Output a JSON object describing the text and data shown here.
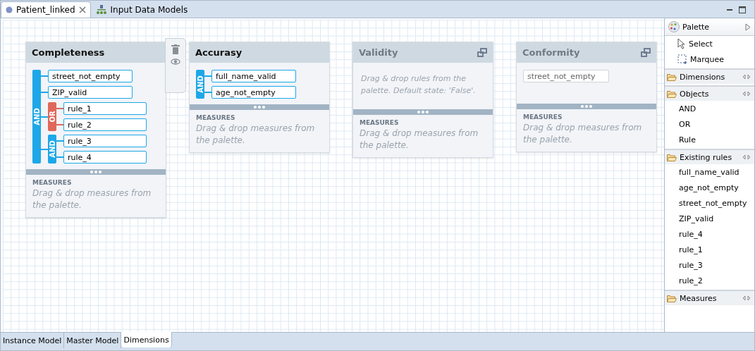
{
  "editor_tabs": [
    {
      "label": "Patient_linked",
      "selected": true,
      "closable": true,
      "kind": "document"
    },
    {
      "label": "Input Data Models",
      "selected": false,
      "closable": false,
      "kind": "model"
    }
  ],
  "cards": [
    {
      "title": "Completeness",
      "selected": true,
      "disabled": false,
      "rules": [
        {
          "kind": "and",
          "label": "AND",
          "children": [
            {
              "kind": "rule",
              "name": "street_not_empty"
            },
            {
              "kind": "rule",
              "name": "ZIP_valid"
            },
            {
              "kind": "or",
              "label": "OR",
              "children": [
                {
                  "kind": "rule",
                  "name": "rule_1"
                },
                {
                  "kind": "rule",
                  "name": "rule_2"
                }
              ]
            },
            {
              "kind": "and",
              "label": "AND",
              "children": [
                {
                  "kind": "rule",
                  "name": "rule_3"
                },
                {
                  "kind": "rule",
                  "name": "rule_4"
                }
              ]
            }
          ]
        }
      ],
      "measures_label": "MEASURES",
      "measures_hint": "Drag & drop measures from the palette."
    },
    {
      "title": "Accurasy",
      "selected": false,
      "disabled": false,
      "rules": [
        {
          "kind": "and",
          "label": "AND",
          "children": [
            {
              "kind": "rule",
              "name": "full_name_valid"
            },
            {
              "kind": "rule",
              "name": "age_not_empty"
            }
          ]
        }
      ],
      "measures_label": "MEASURES",
      "measures_hint": "Drag & drop measures from the palette."
    },
    {
      "title": "Validity",
      "selected": false,
      "disabled": true,
      "rules_hint": "Drag & drop rules from the palette. Default state: 'False'.",
      "measures_label": "MEASURES",
      "measures_hint": "Drag & drop measures from the palette."
    },
    {
      "title": "Conformity",
      "selected": false,
      "disabled": true,
      "rules": [
        {
          "kind": "rule",
          "name": "street_not_empty"
        }
      ],
      "measures_label": "MEASURES",
      "measures_hint": "Drag & drop measures from the palette."
    }
  ],
  "palette": {
    "title": "Palette",
    "tools": [
      {
        "label": "Select",
        "kind": "select"
      },
      {
        "label": "Marquee",
        "kind": "marquee"
      }
    ],
    "drawers": [
      {
        "label": "Dimensions"
      },
      {
        "label": "Objects",
        "items": [
          "AND",
          "OR",
          "Rule"
        ]
      },
      {
        "label": "Existing rules",
        "items": [
          "full_name_valid",
          "age_not_empty",
          "street_not_empty",
          "ZIP_valid",
          "rule_4",
          "rule_1",
          "rule_3",
          "rule_2"
        ]
      },
      {
        "label": "Measures"
      }
    ]
  },
  "bottom_tabs": [
    {
      "label": "Instance Model",
      "selected": false
    },
    {
      "label": "Master Model",
      "selected": false
    },
    {
      "label": "Dimensions",
      "selected": true
    }
  ]
}
